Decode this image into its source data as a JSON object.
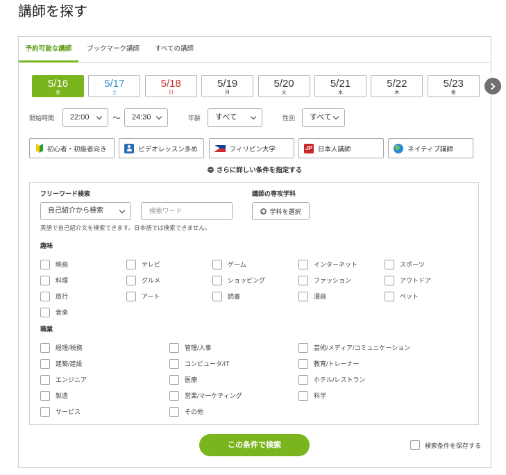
{
  "page": {
    "title": "講師を探す"
  },
  "tabs": [
    {
      "label": "予約可能な講師",
      "active": true
    },
    {
      "label": "ブックマーク講師",
      "active": false
    },
    {
      "label": "すべての講師",
      "active": false
    }
  ],
  "dates": [
    {
      "date": "5/16",
      "weekday": "金",
      "selected": true
    },
    {
      "date": "5/17",
      "weekday": "土",
      "selected": false
    },
    {
      "date": "5/18",
      "weekday": "日",
      "selected": false
    },
    {
      "date": "5/19",
      "weekday": "月",
      "selected": false
    },
    {
      "date": "5/20",
      "weekday": "火",
      "selected": false
    },
    {
      "date": "5/21",
      "weekday": "水",
      "selected": false
    },
    {
      "date": "5/22",
      "weekday": "木",
      "selected": false
    },
    {
      "date": "5/23",
      "weekday": "金",
      "selected": false
    }
  ],
  "date_nav": {
    "next_icon": "chevron-right-icon"
  },
  "filters": {
    "start_time_label": "開始時間",
    "start_time": "22:00",
    "range_separator": "～",
    "end_time": "24:30",
    "age_label": "年齢",
    "age": "すべて",
    "gender_label": "性別",
    "gender": "すべて"
  },
  "features": [
    {
      "label": "初心者・初級者向き",
      "icon": "beginner-mark-icon"
    },
    {
      "label": "ビデオレッスン多め",
      "icon": "video-lesson-icon"
    },
    {
      "label": "フィリピン大学",
      "icon": "philippines-flag-icon"
    },
    {
      "label": "日本人講師",
      "icon": "jp-badge-icon",
      "badge": "JP"
    },
    {
      "label": "ネイティブ講師",
      "icon": "globe-icon"
    }
  ],
  "more_conditions": {
    "label": "さらに詳しい条件を指定する",
    "icon": "minus-circle-icon"
  },
  "detail": {
    "freeword_label": "フリーワード検索",
    "freeword_mode": "自己紹介から検索",
    "freeword_value": "",
    "freeword_placeholder": "検索ワード",
    "major_label": "講師の専攻学科",
    "major_button": "学科を選択",
    "freeword_note": "英語で自己紹介文を検索できます。日本語では検索できません。",
    "hobbies_label": "趣味",
    "hobbies": [
      "映画",
      "テレビ",
      "ゲーム",
      "インターネット",
      "スポーツ",
      "料理",
      "グルメ",
      "ショッピング",
      "ファッション",
      "アウトドア",
      "旅行",
      "アート",
      "読書",
      "漫画",
      "ペット",
      "音楽"
    ],
    "occupation_label": "職業",
    "occupations": [
      "経理/税務",
      "建築/建設",
      "エンジニア",
      "製造",
      "サービス",
      "管理/人事",
      "コンピュータ/IT",
      "医療",
      "営業/マーケティング",
      "その他",
      "芸術/メディア/コミュニケーション",
      "教育/トレーナー",
      "ホテル/レストラン",
      "科学"
    ]
  },
  "actions": {
    "search_button": "この条件で検索",
    "save_label": "検索条件を保存する"
  },
  "colors": {
    "accent_green": "#7ab51d",
    "tab_active_text": "#5f9c17",
    "saturday": "#2e8ec6",
    "sunday": "#c9302c",
    "jp_badge": "#c8282a",
    "next_button": "#6f6f6f"
  }
}
